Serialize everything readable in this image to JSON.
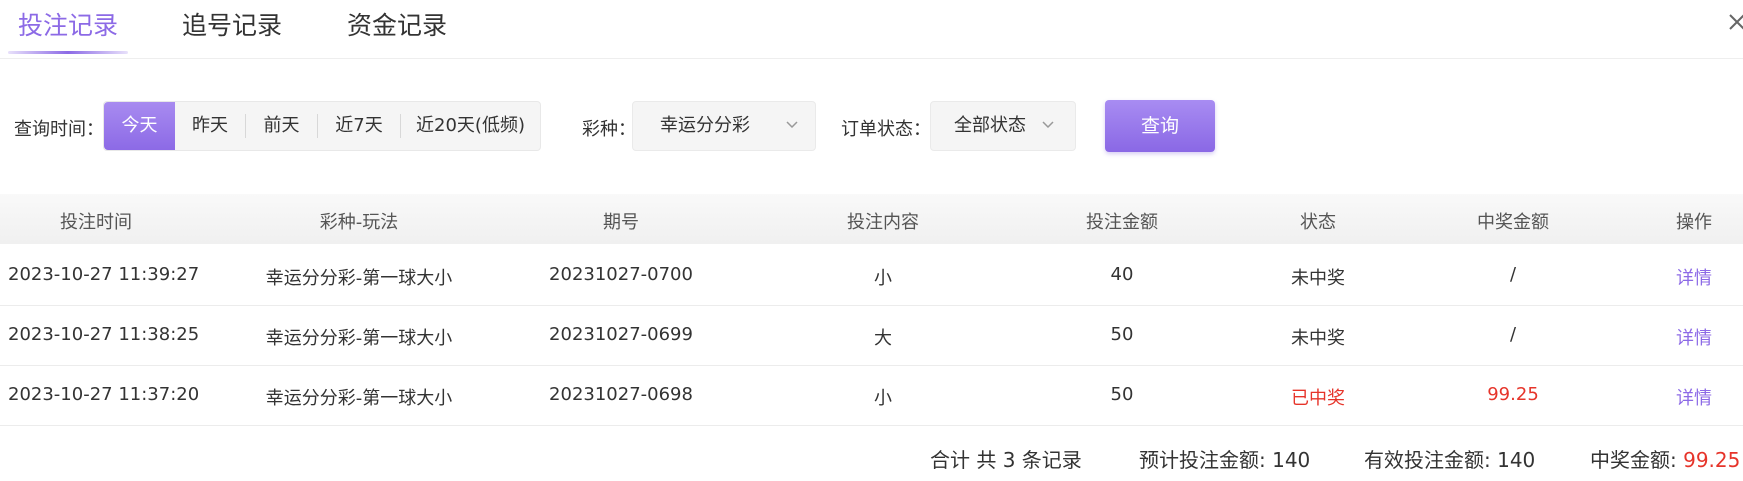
{
  "tabs": [
    {
      "label": "投注记录",
      "active": true
    },
    {
      "label": "追号记录",
      "active": false
    },
    {
      "label": "资金记录",
      "active": false
    }
  ],
  "close_icon": "close-icon",
  "filters": {
    "time_label": "查询时间：",
    "time_options": [
      "今天",
      "昨天",
      "前天",
      "近7天",
      "近20天(低频)"
    ],
    "time_selected": "今天",
    "lottery_label": "彩种：",
    "lottery_value": "幸运分分彩",
    "status_label": "订单状态：",
    "status_value": "全部状态",
    "query_button": "查询"
  },
  "table": {
    "columns": [
      "投注时间",
      "彩种-玩法",
      "期号",
      "投注内容",
      "投注金额",
      "状态",
      "中奖金额",
      "操作"
    ],
    "rows": [
      {
        "time": "2023-10-27 11:39:27",
        "game": "幸运分分彩-第一球大小",
        "period": "20231027-0700",
        "content": "小",
        "amount": "40",
        "status": "未中奖",
        "prize": "/",
        "action": "详情",
        "won": false
      },
      {
        "time": "2023-10-27 11:38:25",
        "game": "幸运分分彩-第一球大小",
        "period": "20231027-0699",
        "content": "大",
        "amount": "50",
        "status": "未中奖",
        "prize": "/",
        "action": "详情",
        "won": false
      },
      {
        "time": "2023-10-27 11:37:20",
        "game": "幸运分分彩-第一球大小",
        "period": "20231027-0698",
        "content": "小",
        "amount": "50",
        "status": "已中奖",
        "prize": "99.25",
        "action": "详情",
        "won": true
      }
    ]
  },
  "summary": {
    "total_label": "合计 共 3 条记录",
    "expected_label": "预计投注金额:",
    "expected_value": "140",
    "effective_label": "有效投注金额:",
    "effective_value": "140",
    "prize_label": "中奖金额:",
    "prize_value": "99.25"
  },
  "colors": {
    "accent": "#8c6ae6",
    "win": "#e6342a"
  }
}
